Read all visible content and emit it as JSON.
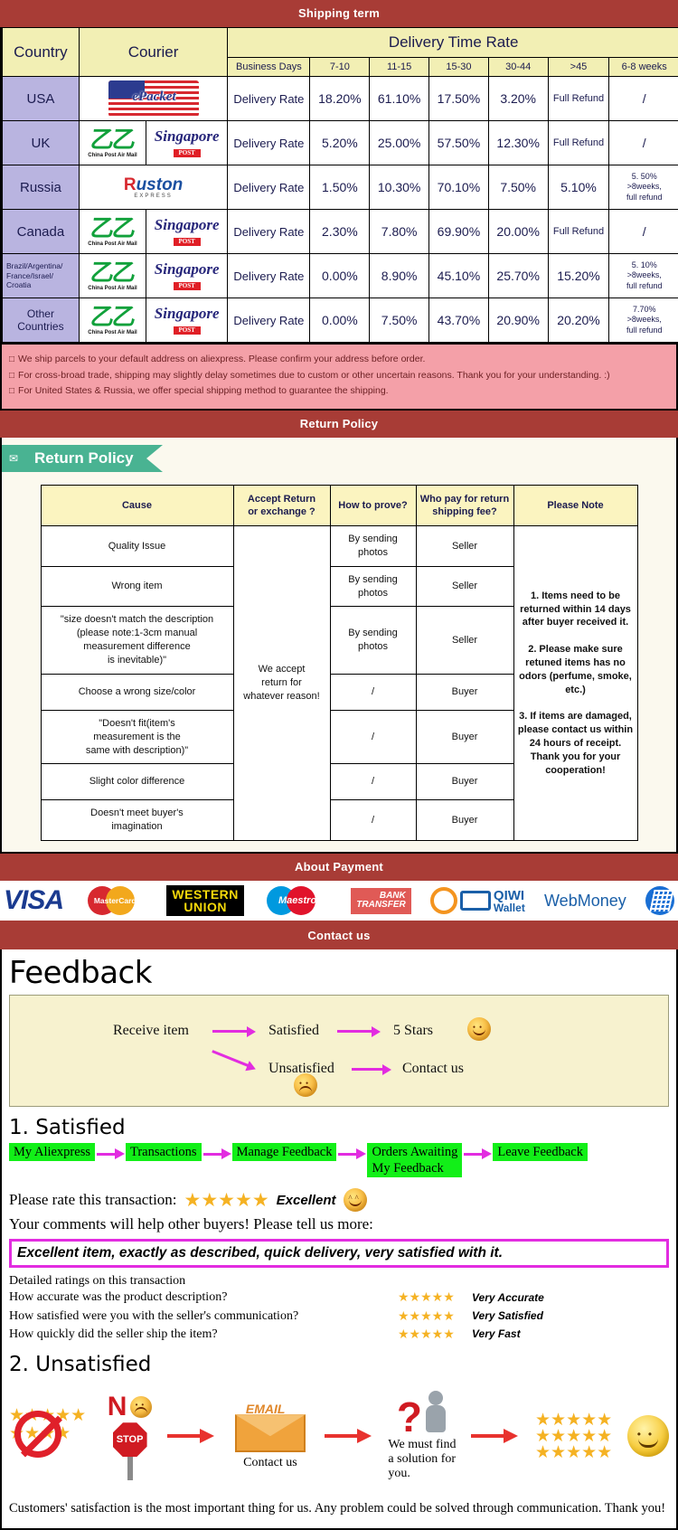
{
  "banners": {
    "shipping": "Shipping term",
    "return": "Return Policy",
    "payment": "About Payment",
    "contact": "Contact us"
  },
  "shipping": {
    "headers": {
      "country": "Country",
      "courier": "Courier",
      "delivery_time_rate": "Delivery Time Rate",
      "business_days": "Business Days",
      "ranges": [
        "7-10",
        "11-15",
        "15-30",
        "30-44",
        ">45",
        "6-8 weeks"
      ]
    },
    "rate_label": "Delivery Rate",
    "rows": [
      {
        "country": "USA",
        "couriers": [
          "epacket"
        ],
        "rates": [
          "18.20%",
          "61.10%",
          "17.50%",
          "3.20%",
          "Full Refund",
          "/"
        ]
      },
      {
        "country": "UK",
        "couriers": [
          "china-post-air-mail",
          "singapore-post"
        ],
        "rates": [
          "5.20%",
          "25.00%",
          "57.50%",
          "12.30%",
          "Full Refund",
          "/"
        ]
      },
      {
        "country": "Russia",
        "couriers": [
          "ruston-express"
        ],
        "rates": [
          "1.50%",
          "10.30%",
          "70.10%",
          "7.50%",
          "5.10%",
          "5. 50%\n>8weeks,\nfull refund"
        ]
      },
      {
        "country": "Canada",
        "couriers": [
          "china-post-air-mail",
          "singapore-post"
        ],
        "rates": [
          "2.30%",
          "7.80%",
          "69.90%",
          "20.00%",
          "Full Refund",
          "/"
        ]
      },
      {
        "country": "Brazil/Argentina/\nFrance/Israel/\nCroatia",
        "couriers": [
          "china-post-air-mail",
          "singapore-post"
        ],
        "rates": [
          "0.00%",
          "8.90%",
          "45.10%",
          "25.70%",
          "15.20%",
          "5. 10%\n>8weeks,\nfull refund"
        ]
      },
      {
        "country": "Other Countries",
        "couriers": [
          "china-post-air-mail",
          "singapore-post"
        ],
        "rates": [
          "0.00%",
          "7.50%",
          "43.70%",
          "20.90%",
          "20.20%",
          "7.70%\n>8weeks,\nfull refund"
        ]
      }
    ],
    "notes": [
      "We ship parcels to your default address on aliexpress. Please confirm your address before order.",
      "For cross-broad trade, shipping may slightly delay sometimes due to custom or other uncertain reasons. Thank you for your understanding. :)",
      "For United States & Russia, we offer special shipping method to guarantee the shipping."
    ],
    "courier_names": {
      "epacket": "ePacket",
      "china_post": "China Post Air Mail",
      "singapore_post_name": "Singapore",
      "singapore_post_tag": "POST",
      "ruston": "Ruston",
      "ruston_sub": "EXPRESS"
    }
  },
  "return_policy": {
    "ribbon_title": "Return Policy",
    "headers": [
      "Cause",
      "Accept Return\nor exchange ?",
      "How to prove?",
      "Who pay for return\nshipping fee?",
      "Please Note"
    ],
    "accept_text": "We accept\nreturn for\nwhatever reason!",
    "rows": [
      {
        "cause": "Quality Issue",
        "prove": "By sending\nphotos",
        "payer": "Seller"
      },
      {
        "cause": "Wrong item",
        "prove": "By sending\nphotos",
        "payer": "Seller"
      },
      {
        "cause": "\"size doesn't match the description\n(please note:1-3cm manual\nmeasurement difference\nis inevitable)\"",
        "prove": "By sending\nphotos",
        "payer": "Seller"
      },
      {
        "cause": "Choose a wrong size/color",
        "prove": "/",
        "payer": "Buyer"
      },
      {
        "cause": "\"Doesn't fit(item's\nmeasurement is the\nsame with description)\"",
        "prove": "/",
        "payer": "Buyer"
      },
      {
        "cause": "Slight color difference",
        "prove": "/",
        "payer": "Buyer"
      },
      {
        "cause": "Doesn't meet buyer's\nimagination",
        "prove": "/",
        "payer": "Buyer"
      }
    ],
    "note": "1. Items need to be returned within 14 days after buyer received it.\n\n2. Please make sure retuned items has no odors (perfume, smoke, etc.)\n\n3. If items are damaged, please contact us within 24 hours of receipt.\nThank you for your cooperation!"
  },
  "payment": {
    "methods": [
      {
        "id": "visa-logo",
        "label": "VISA"
      },
      {
        "id": "mastercard-logo",
        "label": "MasterCard"
      },
      {
        "id": "western-union-logo",
        "label_line1": "WESTERN",
        "label_line2": "UNION"
      },
      {
        "id": "maestro-logo",
        "label": "Maestro"
      },
      {
        "id": "bank-transfer-logo",
        "label_line1": "BANK",
        "label_line2": "TRANSFER"
      },
      {
        "id": "qiwi-wallet-logo",
        "label_line1": "QIWI",
        "label_line2": "Wallet"
      },
      {
        "id": "webmoney-logo",
        "label": "WebMoney"
      }
    ]
  },
  "feedback": {
    "title": "Feedback",
    "flow": {
      "receive_item": "Receive item",
      "satisfied": "Satisfied",
      "five_stars": "5 Stars",
      "unsatisfied": "Unsatisfied",
      "contact_us": "Contact us"
    },
    "satisfied_heading": "1. Satisfied",
    "chain": [
      "My Aliexpress",
      "Transactions",
      "Manage Feedback",
      "Orders Awaiting\nMy Feedback",
      "Leave Feedback"
    ],
    "rate_prompt": "Please rate this transaction:",
    "stars": "★★★★★",
    "rating_word": "Excellent",
    "tell_more": "Your comments will help other buyers! Please tell us more:",
    "comment": "Excellent item, exactly as described, quick delivery, very satisfied with it.",
    "detailed_heading": "Detailed ratings on this transaction",
    "detailed_rows": [
      {
        "question": "How accurate was the product description?",
        "stars": "★★★★★",
        "value": "Very Accurate"
      },
      {
        "question": "How satisfied were you with the seller's communication?",
        "stars": "★★★★★",
        "value": "Very Satisfied"
      },
      {
        "question": "How quickly did the seller ship the item?",
        "stars": "★★★★★",
        "value": "Very Fast"
      }
    ],
    "unsatisfied_heading": "2. Unsatisfied",
    "unsatisfied": {
      "no_letter": "N",
      "stop": "STOP",
      "email": "EMAIL",
      "contact_caption": "Contact us",
      "solution_caption": "We must find\na solution for\nyou.",
      "bad_stars": "★★★★",
      "good_stars": "★★★★★"
    },
    "closing": "Customers' satisfaction is the most important thing for us. Any problem could be solved through communication. Thank you!"
  }
}
